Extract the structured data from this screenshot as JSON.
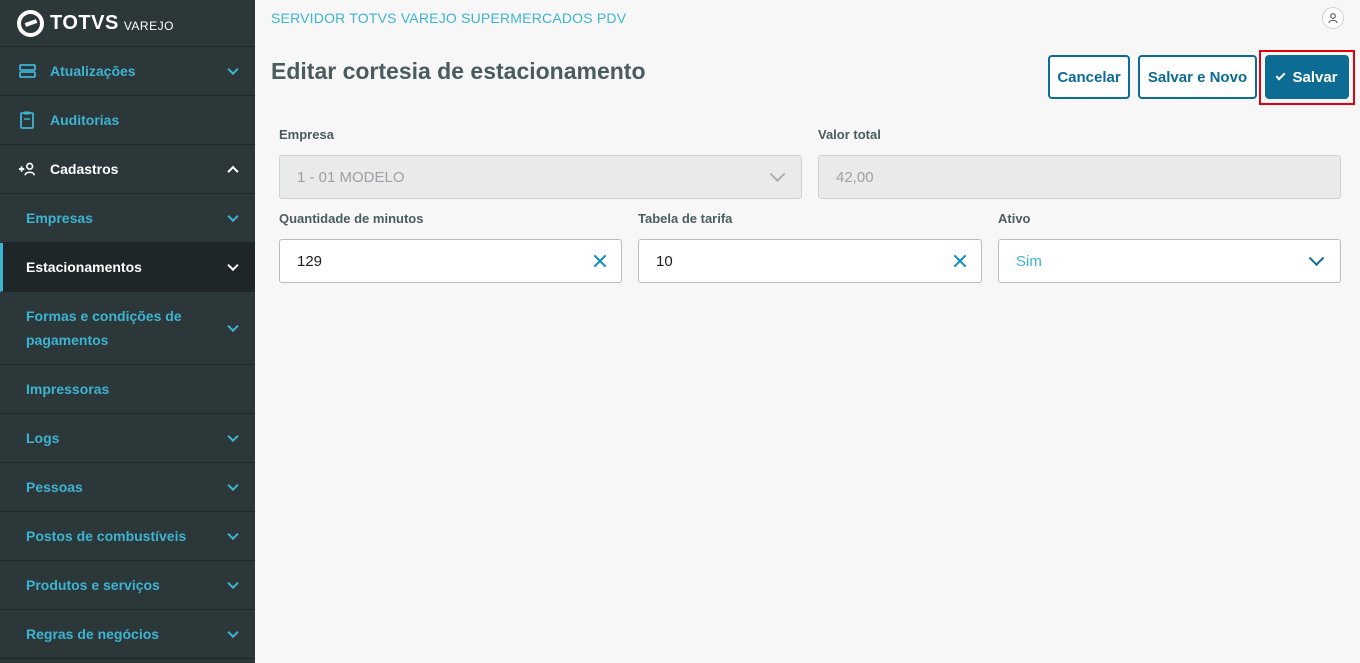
{
  "app": {
    "logo_text": "TOTVS",
    "logo_sub": "VAREJO",
    "server_title": "SERVIDOR TOTVS VAREJO SUPERMERCADOS PDV"
  },
  "sidebar": {
    "items": [
      {
        "label": "Atualizações",
        "icon": "server-icon"
      },
      {
        "label": "Auditorias",
        "icon": "clipboard-icon"
      },
      {
        "label": "Cadastros",
        "icon": "add-user-icon"
      }
    ],
    "subitems": [
      {
        "label": "Empresas"
      },
      {
        "label": "Estacionamentos"
      },
      {
        "label": "Formas e condições de pagamentos"
      },
      {
        "label": "Impressoras"
      },
      {
        "label": "Logs"
      },
      {
        "label": "Pessoas"
      },
      {
        "label": "Postos de combustíveis"
      },
      {
        "label": "Produtos e serviços"
      },
      {
        "label": "Regras de negócios"
      }
    ]
  },
  "page": {
    "title": "Editar cortesia de estacionamento"
  },
  "toolbar": {
    "cancel_label": "Cancelar",
    "save_new_label": "Salvar e Novo",
    "save_label": "Salvar"
  },
  "form": {
    "empresa": {
      "label": "Empresa",
      "value": "1 - 01 MODELO"
    },
    "valor_total": {
      "label": "Valor total",
      "value": "42,00"
    },
    "quantidade_minutos": {
      "label": "Quantidade de minutos",
      "value": "129"
    },
    "tabela_tarifa": {
      "label": "Tabela de tarifa",
      "value": "10"
    },
    "ativo": {
      "label": "Ativo",
      "value": "Sim"
    }
  },
  "colors": {
    "sidebar_bg": "#2c3739",
    "accent": "#3db4d2",
    "primary": "#0c6c94",
    "highlight": "#e5000e"
  }
}
